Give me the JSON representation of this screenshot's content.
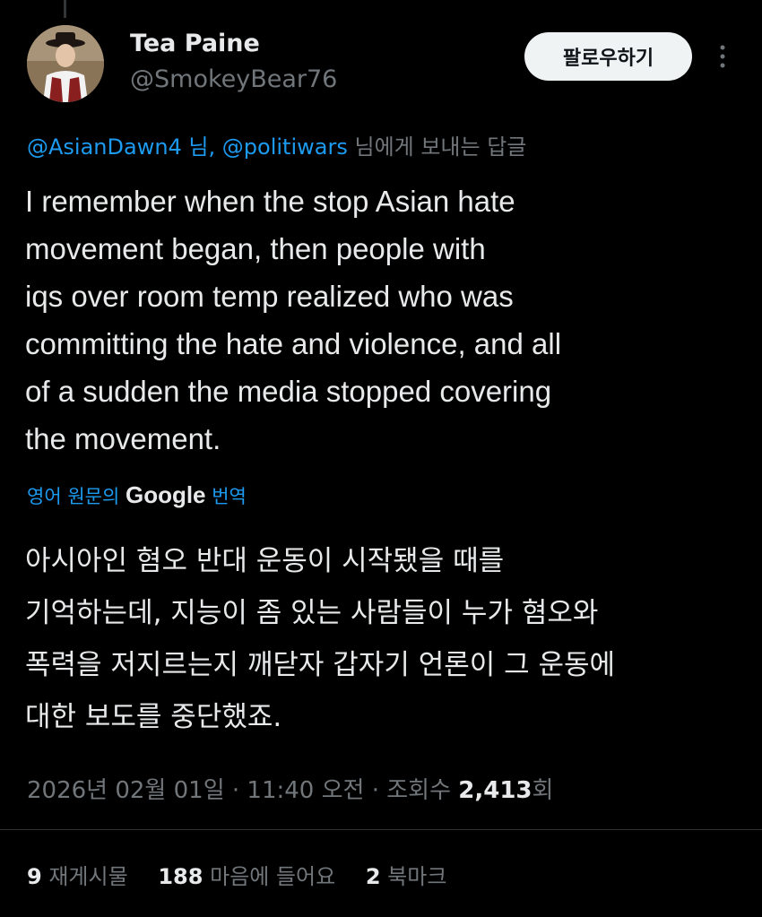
{
  "author": {
    "name": "Tea Paine",
    "handle": "@SmokeyBear76"
  },
  "follow_button": "팔로우하기",
  "reply_to": {
    "mention1": "@AsianDawn4 님,",
    "mention2": "@politiwars",
    "suffix": "님에게 보내는 답글"
  },
  "tweet_lines": [
    "I remember when the stop Asian hate",
    "movement began, then people with",
    "iqs over room temp realized who was",
    "committing the hate and violence, and all",
    "of a sudden the media stopped covering",
    "the movement."
  ],
  "translation": {
    "prefix": "영어 원문의",
    "google": "Google",
    "suffix": "번역"
  },
  "translated_lines": [
    "아시아인 혐오 반대 운동이 시작됐을 때를",
    "기억하는데, 지능이 좀 있는 사람들이 누가 혐오와",
    "폭력을 저지르는지 깨닫자 갑자기 언론이 그 운동에",
    "대한 보도를 중단했죠."
  ],
  "meta": {
    "datetime": "2026년 02월 01일 · 11:40 오전 · 조회수",
    "views": "2,413",
    "views_suffix": "회"
  },
  "stats": {
    "retweets": "9",
    "retweets_label": "재게시물",
    "likes": "188",
    "likes_label": "마음에 들어요",
    "bookmarks": "2",
    "bookmarks_label": "북마크"
  },
  "icons": {
    "avatar": "profile-photo",
    "more": "more-vertical-icon"
  },
  "colors": {
    "background": "#000000",
    "text": "#e7e9ea",
    "muted": "#71767b",
    "accent": "#1d9bf0"
  }
}
